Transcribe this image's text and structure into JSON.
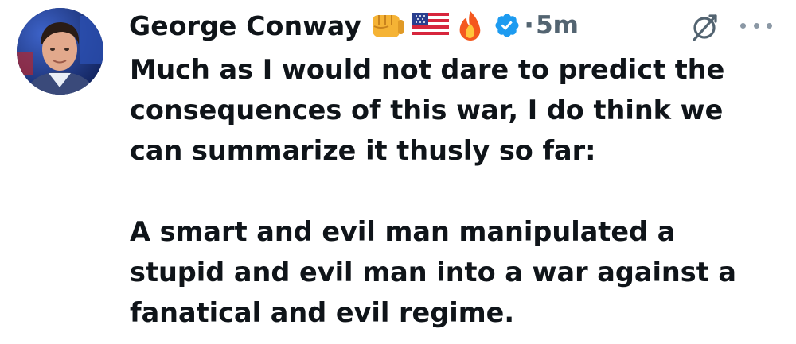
{
  "author": {
    "display_name": "George Conway",
    "emojis": [
      "oncoming-fist-emoji",
      "us-flag-emoji",
      "fire-emoji"
    ],
    "verified": true,
    "verified_color": "#1d9bf0",
    "time_separator": "·",
    "timestamp": "5m"
  },
  "actions": {
    "grok_icon": "grok-icon",
    "more_icon": "more-icon"
  },
  "tweet": {
    "paragraphs": [
      "Much as I would not dare to predict the\nconsequences of this war, I do think we\ncan summarize it thusly so far:",
      "A smart and evil man manipulated a\nstupid and evil man into a war against a\nfanatical and evil regime."
    ]
  },
  "colors": {
    "text": "#0f1419",
    "secondary": "#536471",
    "verified": "#1d9bf0"
  }
}
